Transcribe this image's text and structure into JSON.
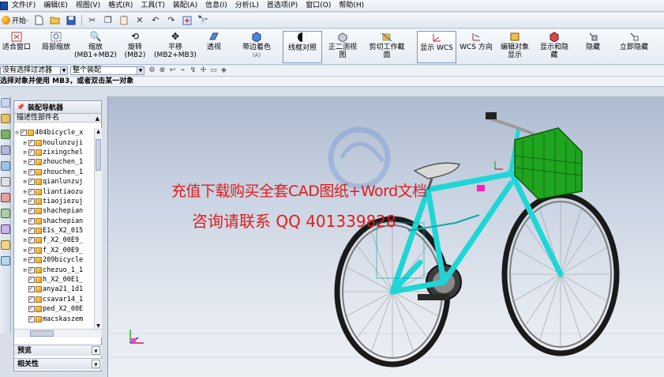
{
  "menu": [
    "文件(F)",
    "编辑(E)",
    "视图(V)",
    "格式(R)",
    "工具(T)",
    "装配(A)",
    "信息(I)",
    "分析(L)",
    "首选项(P)",
    "窗口(O)",
    "帮助(H)"
  ],
  "std_toolbar": {
    "start_label": "开始·",
    "icons": [
      "new-file-icon",
      "open-folder-icon",
      "save-icon",
      "cut-icon",
      "copy-icon",
      "paste-icon",
      "delete-icon",
      "undo-icon",
      "redo-icon",
      "repeat-command-icon",
      "command-finder-icon"
    ]
  },
  "big_toolbar": [
    {
      "label": "适合窗口",
      "icon": "fit-window-icon"
    },
    {
      "label": "局部缩放",
      "icon": "zoom-region-icon"
    },
    {
      "label": "缩放\n(MB1+MB2)",
      "icon": "zoom-icon"
    },
    {
      "label": "旋转\n(MB2)",
      "icon": "rotate-icon"
    },
    {
      "label": "平移\n(MB2+MB3)",
      "icon": "pan-icon"
    },
    {
      "label": "透视",
      "icon": "perspective-icon"
    },
    {
      "label": "带边着色",
      "icon": "shaded-with-edges-icon"
    },
    {
      "label": "线框对照",
      "icon": "wireframe-contrast-icon"
    },
    {
      "label": "正二测视图",
      "icon": "trimetric-view-icon"
    },
    {
      "label": "剪切工作截面",
      "icon": "clip-section-icon"
    },
    {
      "label": "显示 WCS",
      "icon": "display-wcs-icon"
    },
    {
      "label": "WCS 方向",
      "icon": "wcs-orient-icon"
    },
    {
      "label": "编辑对象显示",
      "icon": "edit-object-display-icon"
    },
    {
      "label": "显示和隐藏",
      "icon": "show-hide-icon"
    },
    {
      "label": "隐藏",
      "icon": "hide-icon"
    },
    {
      "label": "立即隐藏",
      "icon": "immediate-hide-icon"
    }
  ],
  "filter_bar": {
    "filter_value": "没有选择过滤器",
    "scope_value": "整个装配"
  },
  "status": "选择对象并使用 MB3，或者双击某一对象",
  "navigator": {
    "title": "装配导航器",
    "column_header": "描述性部件名",
    "items": [
      {
        "name": "404bicycle_x",
        "expandable": false,
        "root": true
      },
      {
        "name": "houlunzuji",
        "expandable": true
      },
      {
        "name": "zixingchel",
        "expandable": true
      },
      {
        "name": "zhouchen_1",
        "expandable": true
      },
      {
        "name": "zhouchen_1",
        "expandable": true
      },
      {
        "name": "qianlunzuj",
        "expandable": true
      },
      {
        "name": "liantiaozu",
        "expandable": true
      },
      {
        "name": "tiaojiezuj",
        "expandable": true
      },
      {
        "name": "shachepian",
        "expandable": true
      },
      {
        "name": "shachepian",
        "expandable": true
      },
      {
        "name": "E1s_X2_015",
        "expandable": true
      },
      {
        "name": "f_X2_00E9_",
        "expandable": true
      },
      {
        "name": "f_X2_00E9_",
        "expandable": true
      },
      {
        "name": "209bicycle",
        "expandable": true
      },
      {
        "name": "chezuo_1_1",
        "expandable": true
      },
      {
        "name": "h_X2_00E1_",
        "expandable": false
      },
      {
        "name": "anya21_1d1",
        "expandable": false
      },
      {
        "name": "csavar14_1",
        "expandable": false
      },
      {
        "name": "ped_X2_00E",
        "expandable": false
      },
      {
        "name": "macskaszem",
        "expandable": false
      }
    ],
    "preview_label": "预览",
    "dependencies_label": "相关性"
  },
  "watermark": {
    "line1": "充值下载购买全套CAD图纸+Word文档",
    "line2": "咨询请联系 QQ 401339828"
  },
  "colors": {
    "frame": "#1fd6d6",
    "basket": "#1fa51f",
    "watermark": "#e21b1b"
  }
}
